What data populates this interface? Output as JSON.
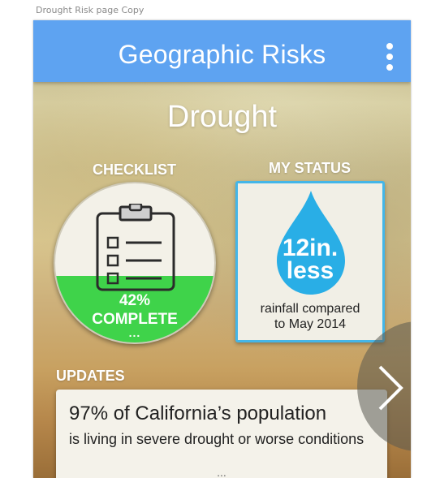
{
  "frame_label": "Drought Risk page Copy",
  "appbar": {
    "title": "Geographic Risks",
    "menu_icon": "more-vertical-icon"
  },
  "page_title": "Drought",
  "checklist": {
    "label": "CHECKLIST",
    "icon": "clipboard-icon",
    "percent_complete": 42,
    "percent_text": "42%",
    "complete_text": "COMPLETE",
    "more_text": "...",
    "fill_color": "#3fd34a"
  },
  "status": {
    "label": "MY STATUS",
    "icon": "water-drop-icon",
    "value_line1": "12in.",
    "value_line2": "less",
    "caption_line1": "rainfall compared",
    "caption_line2": "to May 2014",
    "accent_color": "#44b6e8"
  },
  "updates": {
    "label": "UPDATES",
    "items": [
      {
        "headline": "97% of California’s population",
        "body": "is living in severe drought or worse conditions",
        "more_text": "..."
      }
    ],
    "next_icon": "chevron-right-icon"
  },
  "colors": {
    "appbar": "#5ea3f1",
    "complete": "#3fd34a",
    "drop": "#29aee6"
  }
}
